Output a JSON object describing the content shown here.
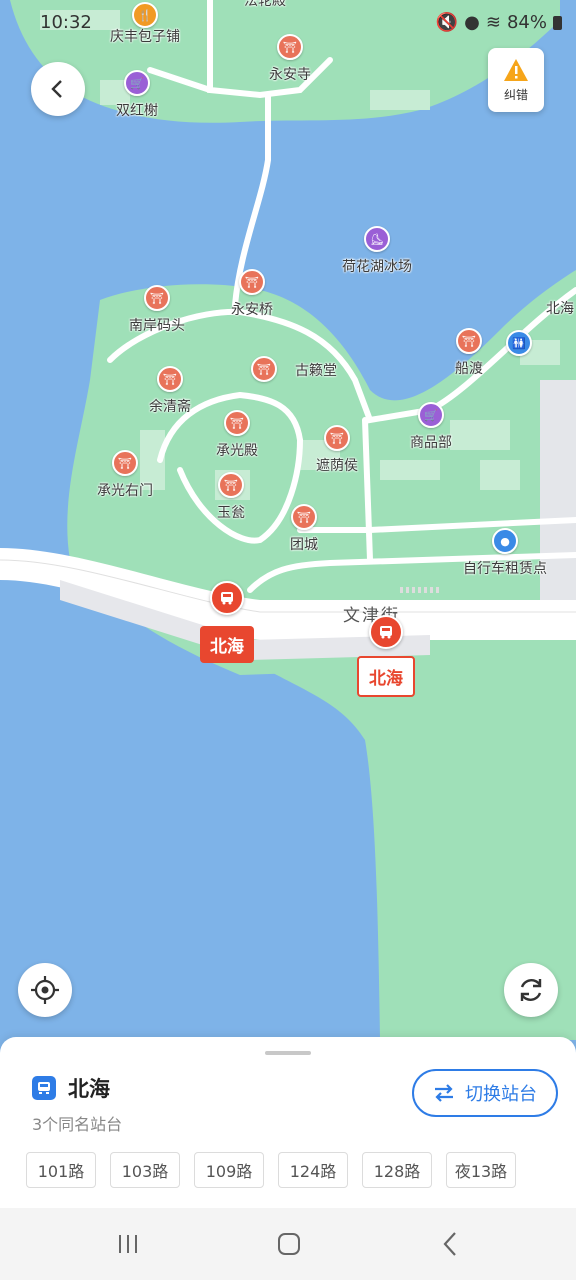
{
  "status_bar": {
    "time": "10:32",
    "battery": "84%"
  },
  "map": {
    "report_button": "纠错",
    "street_name": "文津街",
    "pois": [
      {
        "name": "法轮殿",
        "kind": "temple"
      },
      {
        "name": "庆丰包子铺",
        "kind": "food"
      },
      {
        "name": "永安寺",
        "kind": "temple"
      },
      {
        "name": "双红榭",
        "kind": "shop"
      },
      {
        "name": "荷花湖冰场",
        "kind": "skating"
      },
      {
        "name": "永安桥",
        "kind": "temple"
      },
      {
        "name": "南岸码头",
        "kind": "temple"
      },
      {
        "name": "北海",
        "kind": "temple"
      },
      {
        "name": "船渡",
        "kind": "temple"
      },
      {
        "name": "古籁堂",
        "kind": "temple"
      },
      {
        "name": "余清斋",
        "kind": "temple"
      },
      {
        "name": "商品部",
        "kind": "shop"
      },
      {
        "name": "承光殿",
        "kind": "temple"
      },
      {
        "name": "遮荫侯",
        "kind": "temple"
      },
      {
        "name": "承光右门",
        "kind": "temple"
      },
      {
        "name": "玉瓮",
        "kind": "temple"
      },
      {
        "name": "团城",
        "kind": "temple"
      },
      {
        "name": "自行车租赁点",
        "kind": "service"
      }
    ],
    "stops": [
      {
        "name": "北海",
        "style": "filled"
      },
      {
        "name": "北海",
        "style": "outline"
      }
    ]
  },
  "sheet": {
    "station_name": "北海",
    "subtitle": "3个同名站台",
    "switch_label": "切换站台",
    "routes": [
      "101路",
      "103路",
      "109路",
      "124路",
      "128路",
      "夜13路"
    ]
  },
  "colors": {
    "water": "#7eb3e8",
    "land": "#9fe0b8",
    "accent": "#2e7ce6",
    "stop_red": "#e8472f"
  }
}
